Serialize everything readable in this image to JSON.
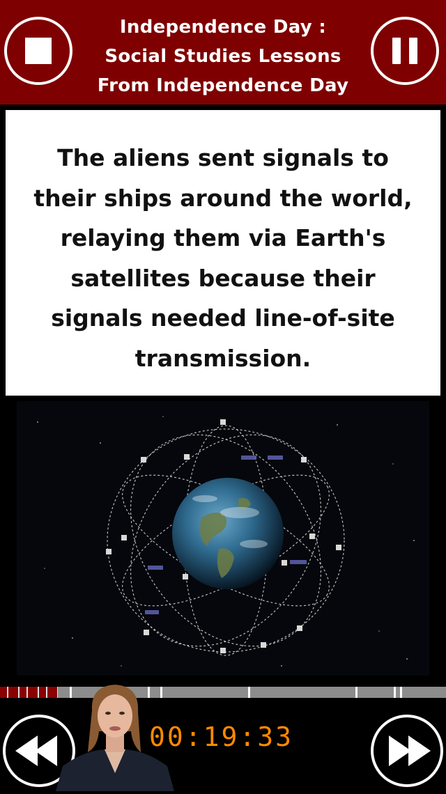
{
  "header": {
    "title_lines": [
      "Independence Day :",
      "Social Studies Lessons",
      "From Independence Day"
    ],
    "stop_icon": "stop-icon",
    "pause_icon": "pause-icon"
  },
  "card": {
    "text": "The aliens sent signals to their ships around the world, relaying them via Earth's satellites because their signals needed line-of-site transmission."
  },
  "image": {
    "subject": "earth-satellites"
  },
  "progress": {
    "fraction": 0.13
  },
  "player": {
    "time": "00:19:33",
    "rewind_icon": "rewind-icon",
    "fast_forward_icon": "fast-forward-icon",
    "presenter": "avatar"
  },
  "colors": {
    "header_bg": "#7f0000",
    "timer": "#ff8a00",
    "progress_track": "#8c8c8c",
    "progress_fill": "#8a0000"
  }
}
